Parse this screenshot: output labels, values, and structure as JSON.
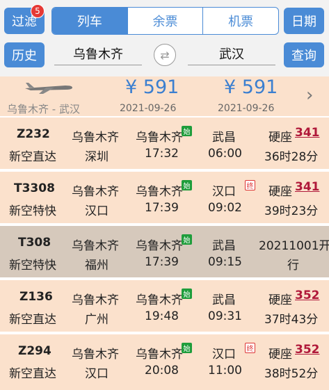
{
  "top": {
    "filter_label": "过滤",
    "filter_badge": "5",
    "tabs": [
      "列车",
      "余票",
      "机票"
    ],
    "date_label": "日期",
    "history_label": "历史",
    "from_station": "乌鲁木齐",
    "to_station": "武汉",
    "query_label": "查询"
  },
  "flight": {
    "route": "乌鲁木齐 - 武汉",
    "price1": "¥ 591",
    "date1": "2021-09-26",
    "price2": "¥ 591",
    "date2": "2021-09-26"
  },
  "trains": [
    {
      "code": "Z232",
      "type": "新空直达",
      "from": "乌鲁木齐",
      "to": "深圳",
      "dep_station": "乌鲁木齐",
      "dep_time": "17:32",
      "arr_station": "武昌",
      "arr_time": "06:00",
      "seat": "硬座",
      "price": "341",
      "duration": "36时28分",
      "start_tag": "始",
      "end_tag": ""
    },
    {
      "code": "T3308",
      "type": "新空特快",
      "from": "乌鲁木齐",
      "to": "汉口",
      "dep_station": "乌鲁木齐",
      "dep_time": "17:39",
      "arr_station": "汉口",
      "arr_time": "09:02",
      "seat": "硬座",
      "price": "341",
      "duration": "39时23分",
      "start_tag": "始",
      "end_tag": "终"
    },
    {
      "code": "T308",
      "type": "新空特快",
      "from": "乌鲁木齐",
      "to": "福州",
      "dep_station": "乌鲁木齐",
      "dep_time": "17:39",
      "arr_station": "武昌",
      "arr_time": "09:15",
      "status_line1": "20211001开",
      "status_line2": "行",
      "start_tag": "始",
      "end_tag": ""
    },
    {
      "code": "Z136",
      "type": "新空直达",
      "from": "乌鲁木齐",
      "to": "广州",
      "dep_station": "乌鲁木齐",
      "dep_time": "19:48",
      "arr_station": "武昌",
      "arr_time": "09:31",
      "seat": "硬座",
      "price": "352",
      "duration": "37时43分",
      "start_tag": "始",
      "end_tag": ""
    },
    {
      "code": "Z294",
      "type": "新空直达",
      "from": "乌鲁木齐",
      "to": "汉口",
      "dep_station": "乌鲁木齐",
      "dep_time": "20:08",
      "arr_station": "汉口",
      "arr_time": "11:00",
      "seat": "硬座",
      "price": "352",
      "duration": "38时52分",
      "start_tag": "始",
      "end_tag": "终"
    }
  ]
}
